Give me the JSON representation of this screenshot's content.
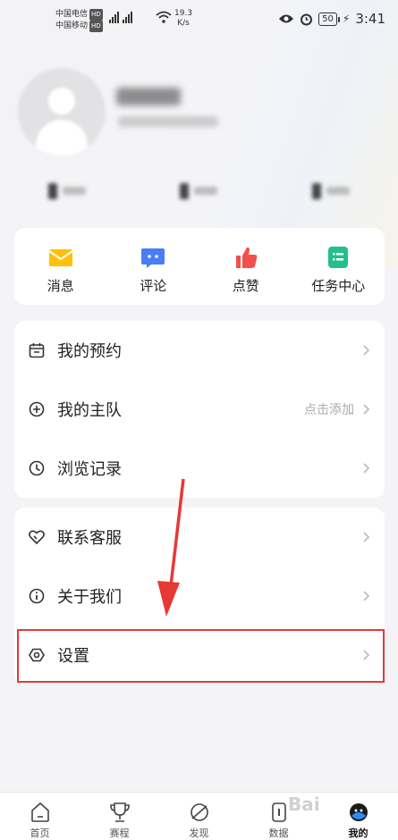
{
  "status_bar": {
    "carrier_1": "中国电信",
    "carrier_2": "中国移动",
    "carrier_tag": "HD",
    "network": "4G",
    "speed_value": "19.3",
    "speed_unit": "K/s",
    "battery": "50",
    "time": "3:41"
  },
  "quick_actions": [
    {
      "label": "消息",
      "icon": "mail-icon",
      "color": "#ffc107"
    },
    {
      "label": "评论",
      "icon": "comment-icon",
      "color": "#4a7cf6"
    },
    {
      "label": "点赞",
      "icon": "thumbs-up-icon",
      "color": "#f0514c"
    },
    {
      "label": "任务中心",
      "icon": "task-list-icon",
      "color": "#22c08a"
    }
  ],
  "menu_group_1": [
    {
      "label": "我的预约",
      "icon": "calendar-icon",
      "hint": ""
    },
    {
      "label": "我的主队",
      "icon": "add-circle-icon",
      "hint": "点击添加"
    },
    {
      "label": "浏览记录",
      "icon": "clock-icon",
      "hint": ""
    }
  ],
  "menu_group_2": [
    {
      "label": "联系客服",
      "icon": "heart-handshake-icon",
      "hint": ""
    },
    {
      "label": "关于我们",
      "icon": "info-icon",
      "hint": ""
    },
    {
      "label": "设置",
      "icon": "settings-hexagon-icon",
      "hint": ""
    }
  ],
  "tabs": [
    {
      "label": "首页",
      "icon": "home-icon"
    },
    {
      "label": "赛程",
      "icon": "trophy-icon"
    },
    {
      "label": "发现",
      "icon": "planet-icon"
    },
    {
      "label": "数据",
      "icon": "data-icon"
    },
    {
      "label": "我的",
      "icon": "profile-avatar-icon"
    }
  ],
  "active_tab": "我的",
  "watermark": "Bai"
}
